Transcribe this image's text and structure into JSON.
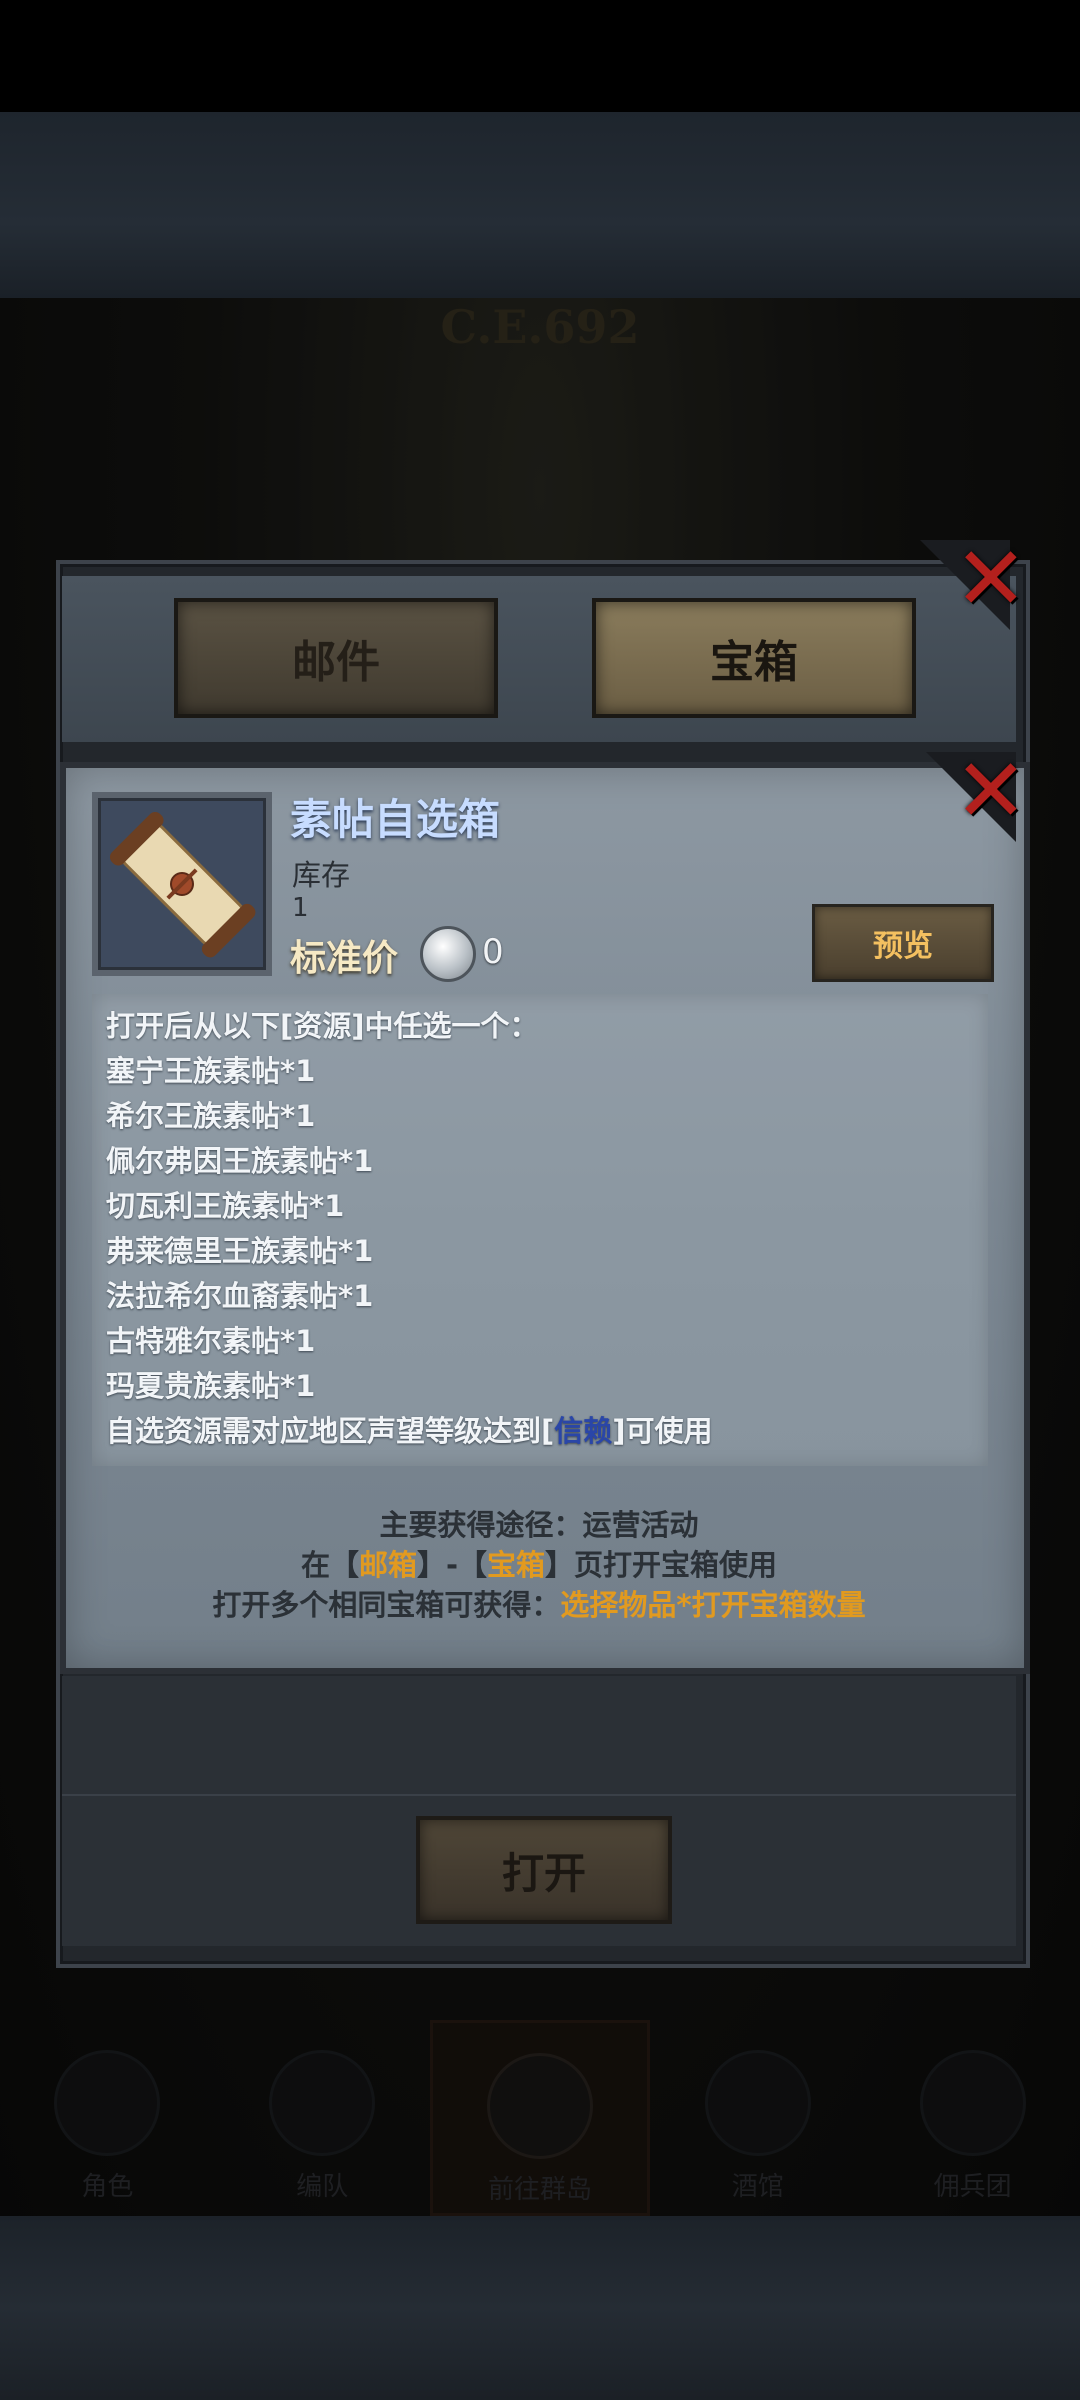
{
  "background": {
    "era_text": "C.E.692",
    "nav": [
      "角色",
      "编队",
      "前往群岛",
      "酒馆",
      "佣兵团"
    ]
  },
  "tabs": [
    "邮件",
    "宝箱"
  ],
  "item": {
    "title": "素帖自选箱",
    "stock_label": "库存",
    "stock_value": "1",
    "price_label": "标准价",
    "price_value": "0",
    "preview_label": "预览"
  },
  "description": {
    "intro": "打开后从以下[资源]中任选一个：",
    "options": [
      "塞宁王族素帖*1",
      "希尔王族素帖*1",
      "佩尔弗因王族素帖*1",
      "切瓦利王族素帖*1",
      "弗莱德里王族素帖*1",
      "法拉希尔血裔素帖*1",
      "古特雅尔素帖*1",
      "玛夏贵族素帖*1"
    ],
    "req_prefix": "自选资源需对应地区声望等级达到[",
    "req_highlight": "信赖",
    "req_suffix": "]可使用"
  },
  "source": {
    "line1": "主要获得途径：运营活动",
    "line2_a": "在【",
    "line2_b": "邮箱",
    "line2_c": "】-【",
    "line2_d": "宝箱",
    "line2_e": "】页打开宝箱使用",
    "line3_a": "打开多个相同宝箱可获得：",
    "line3_b": "选择物品*打开宝箱数量"
  },
  "open_button": "打开",
  "colors": {
    "title_blue": "#c7dcff",
    "highlight_orange": "#e29a1f",
    "highlight_blue": "#2a46a8",
    "close_red": "#b3201d"
  }
}
